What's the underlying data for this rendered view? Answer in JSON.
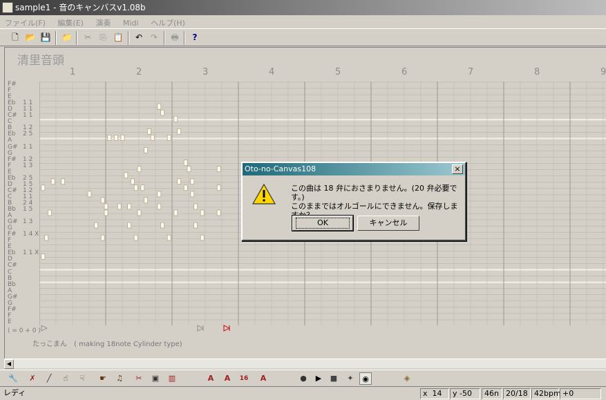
{
  "window": {
    "title": "sample1 - 音のキャンバスv1.08b"
  },
  "menu": [
    "ファイル(F)",
    "編集(E)",
    "演奏",
    "Midi",
    "ヘルプ(H)"
  ],
  "song": {
    "title": "清里音頭",
    "measures": [
      "1",
      "2",
      "3",
      "4",
      "5",
      "6",
      "7",
      "8",
      "9"
    ],
    "footnote": "( = 0 + 0 )",
    "credit": "たっこまん　( making 18note Cylinder type)"
  },
  "pitches": [
    {
      "name": "F#",
      "count": ""
    },
    {
      "name": "F",
      "count": ""
    },
    {
      "name": "E",
      "count": ""
    },
    {
      "name": "Eb",
      "count": "1 1"
    },
    {
      "name": "D",
      "count": "1 1"
    },
    {
      "name": "C#",
      "count": "1 1"
    },
    {
      "name": "C",
      "count": ""
    },
    {
      "name": "B",
      "count": "1 2"
    },
    {
      "name": "Eb",
      "count": "2 5"
    },
    {
      "name": "A",
      "count": ""
    },
    {
      "name": "G#",
      "count": "1 1"
    },
    {
      "name": "G",
      "count": ""
    },
    {
      "name": "F#",
      "count": "1 2"
    },
    {
      "name": "F",
      "count": "1 3"
    },
    {
      "name": "E",
      "count": ""
    },
    {
      "name": "Eb",
      "count": "2 5"
    },
    {
      "name": "D",
      "count": "1 5"
    },
    {
      "name": "C#",
      "count": "1 2"
    },
    {
      "name": "C",
      "count": "1 1"
    },
    {
      "name": "B",
      "count": "2 4"
    },
    {
      "name": "Bb",
      "count": "1 5"
    },
    {
      "name": "A",
      "count": ""
    },
    {
      "name": "G#",
      "count": "1 3"
    },
    {
      "name": "G",
      "count": ""
    },
    {
      "name": "F#",
      "count": "1 4 X"
    },
    {
      "name": "F",
      "count": ""
    },
    {
      "name": "E",
      "count": ""
    },
    {
      "name": "Eb",
      "count": "1 1 X"
    },
    {
      "name": "D",
      "count": ""
    },
    {
      "name": "C#",
      "count": ""
    },
    {
      "name": "C",
      "count": ""
    },
    {
      "name": "B",
      "count": ""
    },
    {
      "name": "Bb",
      "count": ""
    },
    {
      "name": "A",
      "count": ""
    },
    {
      "name": "G#",
      "count": ""
    },
    {
      "name": "G",
      "count": ""
    },
    {
      "name": "F#",
      "count": ""
    },
    {
      "name": "F",
      "count": ""
    },
    {
      "name": "E",
      "count": ""
    }
  ],
  "notes": [
    [
      14,
      1.3
    ],
    [
      15,
      1.4
    ],
    [
      16,
      1.55
    ],
    [
      17,
      1.8
    ],
    [
      18,
      1.6
    ],
    [
      19,
      1.35
    ],
    [
      20,
      1.0
    ],
    [
      7,
      1.65
    ],
    [
      8,
      1.05
    ],
    [
      8,
      1.15
    ],
    [
      8,
      1.25
    ],
    [
      8,
      1.7
    ],
    [
      8,
      1.95
    ],
    [
      7,
      2.1
    ],
    [
      3,
      1.8
    ],
    [
      4,
      1.85
    ],
    [
      5,
      2.05
    ],
    [
      10,
      1.6
    ],
    [
      12,
      2.2
    ],
    [
      13,
      2.25
    ],
    [
      13,
      1.5
    ],
    [
      13,
      2.7
    ],
    [
      15,
      0.2
    ],
    [
      15,
      0.35
    ],
    [
      15,
      2.1
    ],
    [
      15,
      2.3
    ],
    [
      16,
      0.05
    ],
    [
      16,
      1.45
    ],
    [
      16,
      2.2
    ],
    [
      16,
      2.7
    ],
    [
      17,
      0.75
    ],
    [
      17,
      2.3
    ],
    [
      18,
      0.95
    ],
    [
      19,
      1.0
    ],
    [
      19,
      1.2
    ],
    [
      19,
      1.8
    ],
    [
      19,
      2.35
    ],
    [
      20,
      0.15
    ],
    [
      20,
      1.5
    ],
    [
      20,
      2.05
    ],
    [
      20,
      2.45
    ],
    [
      20,
      2.7
    ],
    [
      22,
      0.85
    ],
    [
      22,
      1.35
    ],
    [
      22,
      1.85
    ],
    [
      22,
      2.35
    ],
    [
      24,
      0.1
    ],
    [
      24,
      0.95
    ],
    [
      24,
      1.45
    ],
    [
      24,
      1.95
    ],
    [
      24,
      2.45
    ],
    [
      27,
      0.05
    ]
  ],
  "toolbar": {
    "icons": [
      "new-icon",
      "open-icon",
      "save-icon",
      "import-icon",
      "cut-icon",
      "copy-icon",
      "paste-icon",
      "undo-icon",
      "redo-icon",
      "print-icon",
      "help-icon"
    ]
  },
  "dialog": {
    "title": "Oto-no-Canvas108",
    "close": "×",
    "line1": "この曲は 18 弁におさまりません。(20 弁必要です。)",
    "line2": "このままではオルゴールにできません。保存しますか？",
    "ok": "OK",
    "cancel": "キャンセル"
  },
  "bottom_toolbar": {
    "labels": [
      "A",
      "A",
      "16",
      "A"
    ]
  },
  "status": {
    "mode": "レディ",
    "x_label": "x",
    "x_value": "14",
    "y_label": "y",
    "y_value": "-50",
    "note_len": "46n",
    "ratio": "20/18",
    "tempo": "42bpm",
    "offset": "+0"
  },
  "colors": {
    "grid_line": "#b8b4a8",
    "measure_line": "#9a968c",
    "hl_line": "#f4f2ea",
    "note_fill": "#fff9f0",
    "accent_red": "#cc2222"
  }
}
